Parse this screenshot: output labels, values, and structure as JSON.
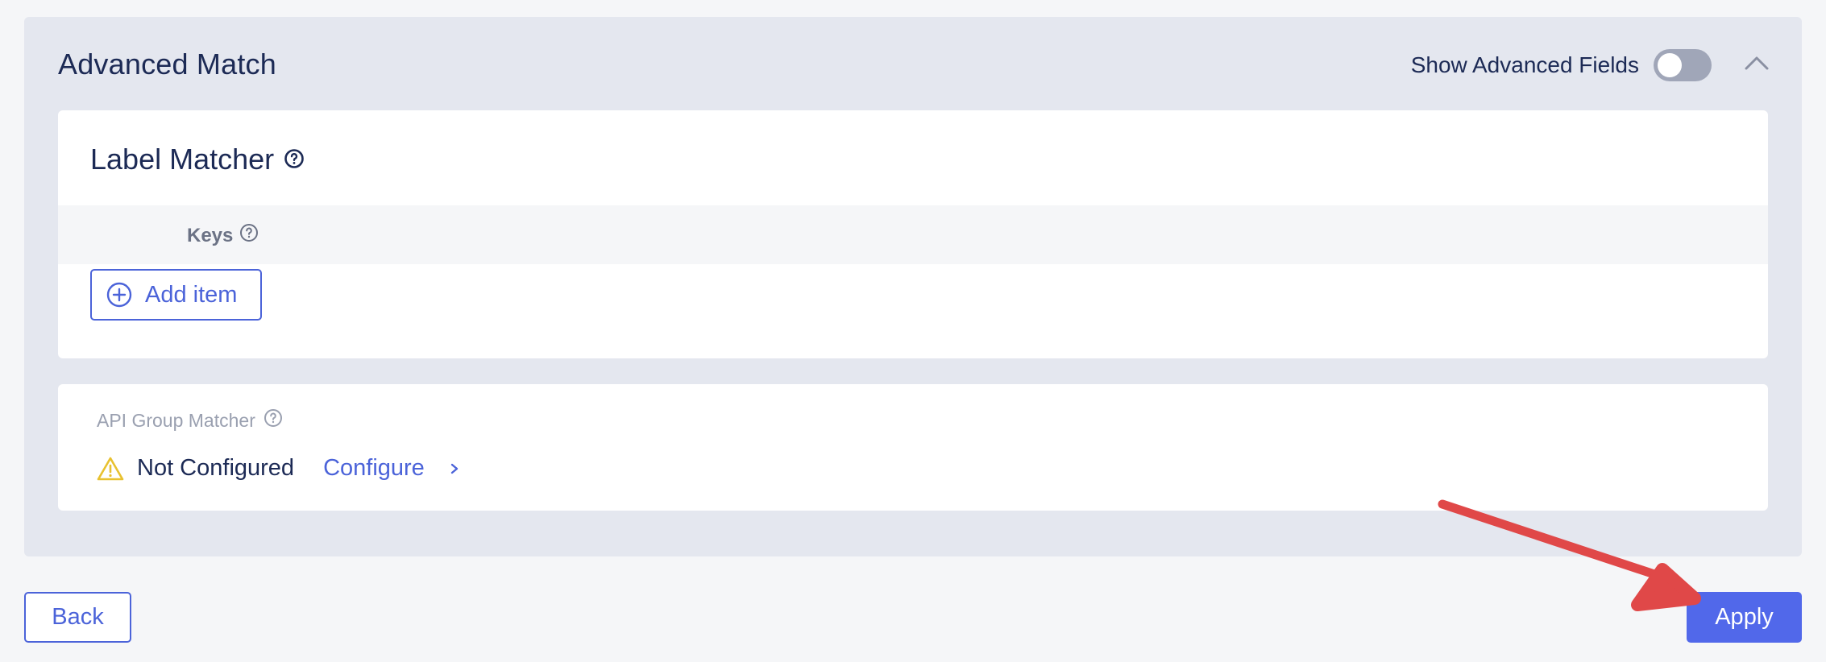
{
  "panel": {
    "title": "Advanced Match",
    "show_advanced_label": "Show Advanced Fields",
    "show_advanced_on": false
  },
  "label_matcher": {
    "title": "Label Matcher",
    "keys_header": "Keys",
    "add_item_label": "Add item"
  },
  "api_group_matcher": {
    "label": "API Group Matcher",
    "status": "Not Configured",
    "configure_label": "Configure"
  },
  "footer": {
    "back_label": "Back",
    "apply_label": "Apply"
  },
  "colors": {
    "accent": "#4b63d9",
    "apply_bg": "#5168ea",
    "warning": "#e8c12f",
    "annotation_arrow": "#e04848"
  },
  "icons": [
    "help-circle-icon",
    "chevron-up-icon",
    "plus-circle-icon",
    "warning-triangle-icon",
    "chevron-right-icon"
  ]
}
